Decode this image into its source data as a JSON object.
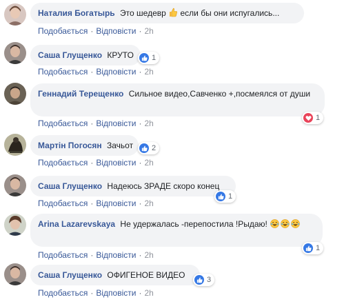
{
  "actions": {
    "like": "Подобається",
    "reply": "Відповісти",
    "dot": "·"
  },
  "colors": {
    "author": "#385898",
    "bubble": "#f2f3f5",
    "like": "#3578e5",
    "love": "#e9445a"
  },
  "comments": [
    {
      "author": "Наталия Богатырь",
      "text": "Это шедевр",
      "text_after": "если бы они испугались...",
      "inline_icon": "thumbs-up-emoji-icon",
      "time": "2h"
    },
    {
      "author": "Саша Глущенко",
      "text": "КРУТО",
      "time": "2h",
      "reaction": {
        "type": "like",
        "icon": "like-reaction-icon",
        "count": "1"
      }
    },
    {
      "author": "Геннадий Терещенко",
      "text": "Сильное видео,Савченко +,посмеялся от души",
      "time": "2h",
      "reaction": {
        "type": "love",
        "icon": "love-reaction-icon",
        "count": "1"
      }
    },
    {
      "author": "Мартін Погосян",
      "text": "Зачьот",
      "time": "2h",
      "reaction": {
        "type": "like",
        "icon": "like-reaction-icon",
        "count": "2"
      }
    },
    {
      "author": "Саша Глущенко",
      "text": "Надеюсь ЗРАДЕ скоро конец",
      "time": "2h",
      "reaction": {
        "type": "like",
        "icon": "like-reaction-icon",
        "count": "1"
      }
    },
    {
      "author": "Arina Lazarevskaya",
      "text": "Не удержалась -перепостила !Рыдаю!",
      "trailing_icons": [
        "laughing-emoji-icon",
        "laughing-emoji-icon",
        "laughing-emoji-icon"
      ],
      "time": "2h",
      "reaction": {
        "type": "like",
        "icon": "like-reaction-icon",
        "count": "1"
      }
    },
    {
      "author": "Саша Глущенко",
      "text": "ОФИГЕНОЕ ВИДЕО",
      "time": "2h",
      "reaction": {
        "type": "like",
        "icon": "like-reaction-icon",
        "count": "3"
      }
    }
  ]
}
